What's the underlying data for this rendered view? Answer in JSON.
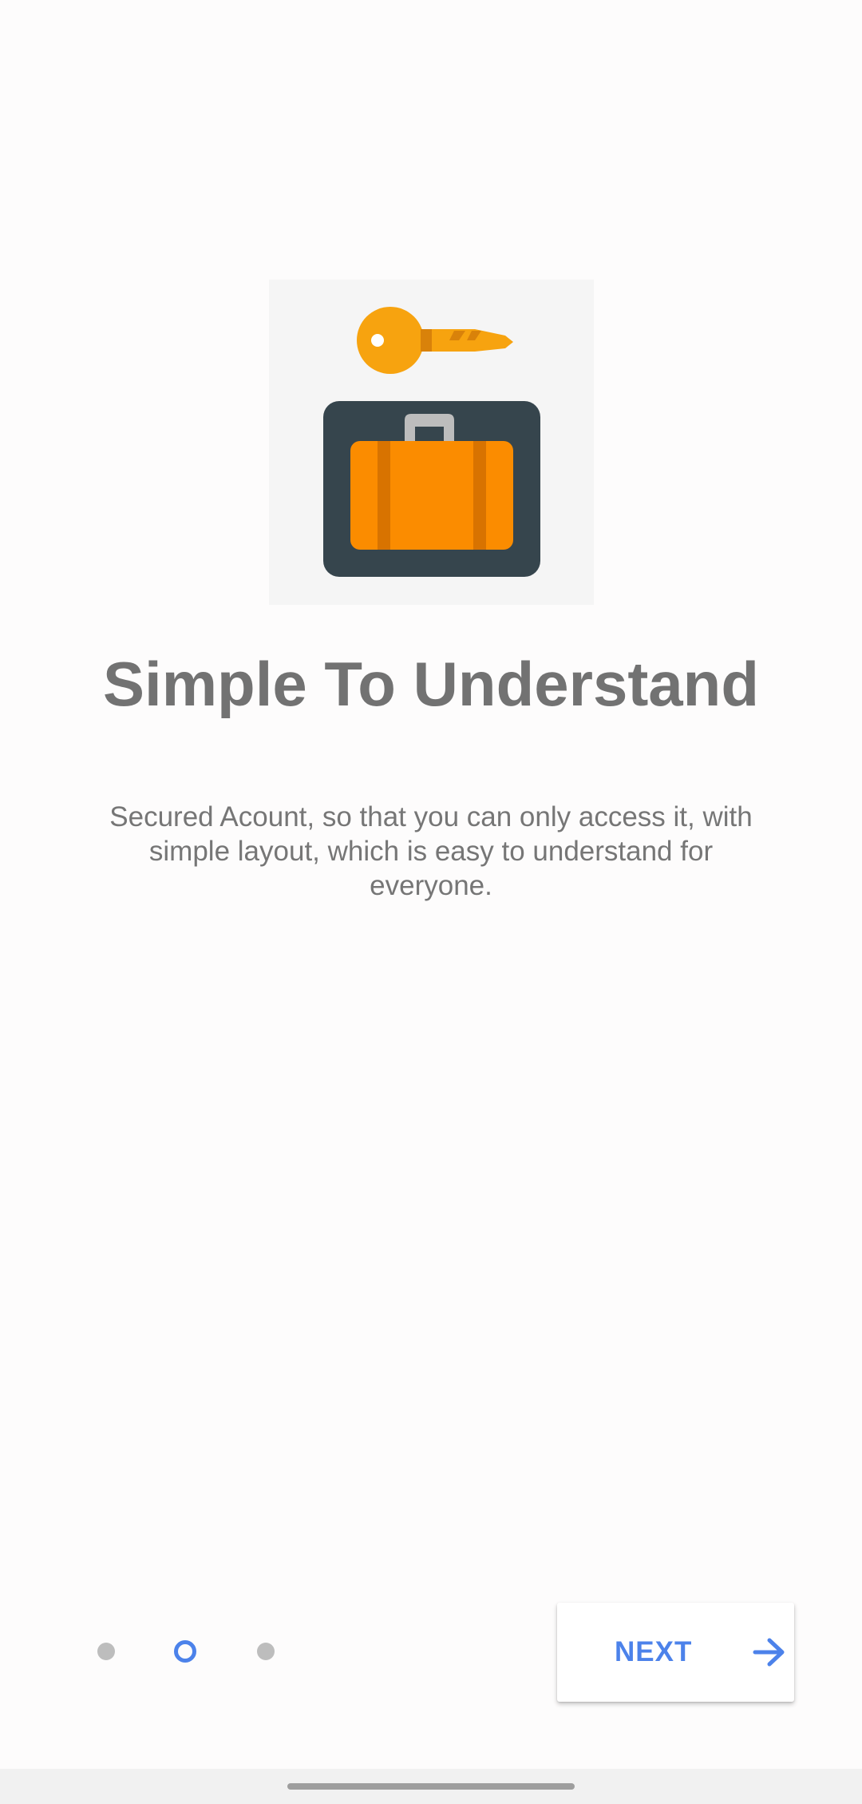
{
  "onboarding": {
    "illustration": {
      "icon": "key-and-briefcase-icon",
      "colors": {
        "background": "#f5f5f5",
        "key": "#f7a30f",
        "key_shadow": "#d9820a",
        "case_panel": "#36454d",
        "briefcase": "#fb8c00",
        "briefcase_stripe": "#d87300",
        "handle": "#bdbdbd"
      }
    },
    "title": "Simple To Understand",
    "description": "Secured Acount, so that you can only access it, with simple layout, which is easy to understand for everyone."
  },
  "pager": {
    "page_count": 3,
    "current_page": 2,
    "active_color": "#4c82ea",
    "inactive_color": "#bdbdbd"
  },
  "next_button": {
    "label": "NEXT",
    "icon": "arrow-right-icon",
    "color": "#4c82ea"
  }
}
